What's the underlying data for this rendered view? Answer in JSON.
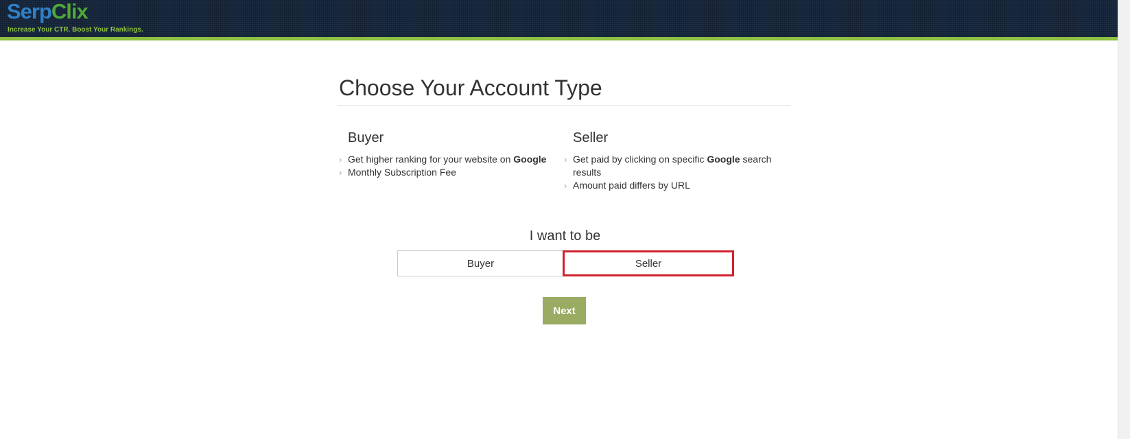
{
  "header": {
    "logo": {
      "part1": "Serp",
      "part2": "Clix"
    },
    "tagline": "Increase Your CTR. Boost Your Rankings.",
    "colors": {
      "bar": "#16263c",
      "accent_line": "#8dc03f"
    }
  },
  "page": {
    "title": "Choose Your Account Type"
  },
  "buyer": {
    "heading": "Buyer",
    "items": [
      {
        "text": "Get higher ranking for your website on ",
        "bold": "Google",
        "after": ""
      },
      {
        "text": "Monthly Subscription Fee",
        "bold": "",
        "after": ""
      }
    ]
  },
  "seller": {
    "heading": "Seller",
    "items": [
      {
        "text": "Get paid by clicking on specific ",
        "bold": "Google",
        "after": " search results"
      },
      {
        "text": "Amount paid differs by URL",
        "bold": "",
        "after": ""
      }
    ]
  },
  "choice": {
    "prompt": "I want to be",
    "options": [
      "Buyer",
      "Seller"
    ],
    "selected": "Seller",
    "highlight_color": "#d0212a"
  },
  "next_button": {
    "label": "Next",
    "color": "#9aab63"
  },
  "icons": {
    "bullet": "chevron-right-icon"
  }
}
